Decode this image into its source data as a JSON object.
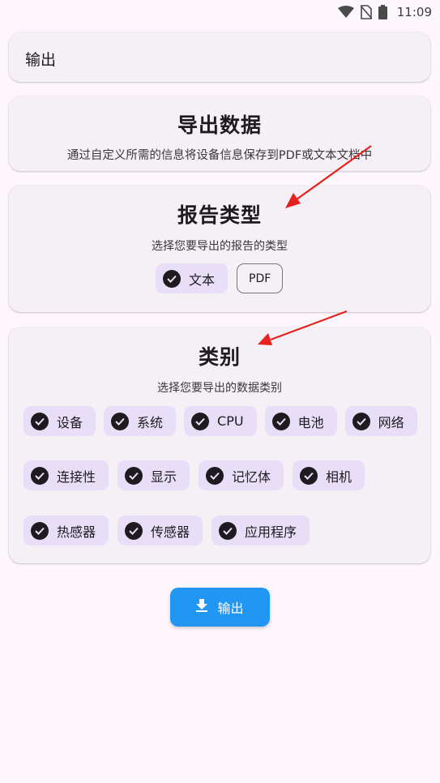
{
  "status_bar": {
    "time": "11:09"
  },
  "output_card": {
    "label": "输出"
  },
  "export_card": {
    "title": "导出数据",
    "description": "通过自定义所需的信息将设备信息保存到PDF或文本文档中"
  },
  "report_type_card": {
    "title": "报告类型",
    "description": "选择您要导出的报告的类型",
    "options": [
      {
        "label": "文本",
        "selected": true
      },
      {
        "label": "PDF",
        "selected": false
      }
    ]
  },
  "category_card": {
    "title": "类别",
    "description": "选择您要导出的数据类别",
    "chips": [
      {
        "label": "设备",
        "selected": true
      },
      {
        "label": "系统",
        "selected": true
      },
      {
        "label": "CPU",
        "selected": true
      },
      {
        "label": "电池",
        "selected": true
      },
      {
        "label": "网络",
        "selected": true
      },
      {
        "label": "连接性",
        "selected": true
      },
      {
        "label": "显示",
        "selected": true
      },
      {
        "label": "记忆体",
        "selected": true
      },
      {
        "label": "相机",
        "selected": true
      },
      {
        "label": "热感器",
        "selected": true
      },
      {
        "label": "传感器",
        "selected": true
      },
      {
        "label": "应用程序",
        "selected": true
      }
    ]
  },
  "output_button": {
    "label": "输出",
    "icon": "download-icon"
  },
  "colors": {
    "primary_button": "#2196f3",
    "chip_selected": "#e8def8",
    "annotation_arrow": "#e8211d"
  }
}
